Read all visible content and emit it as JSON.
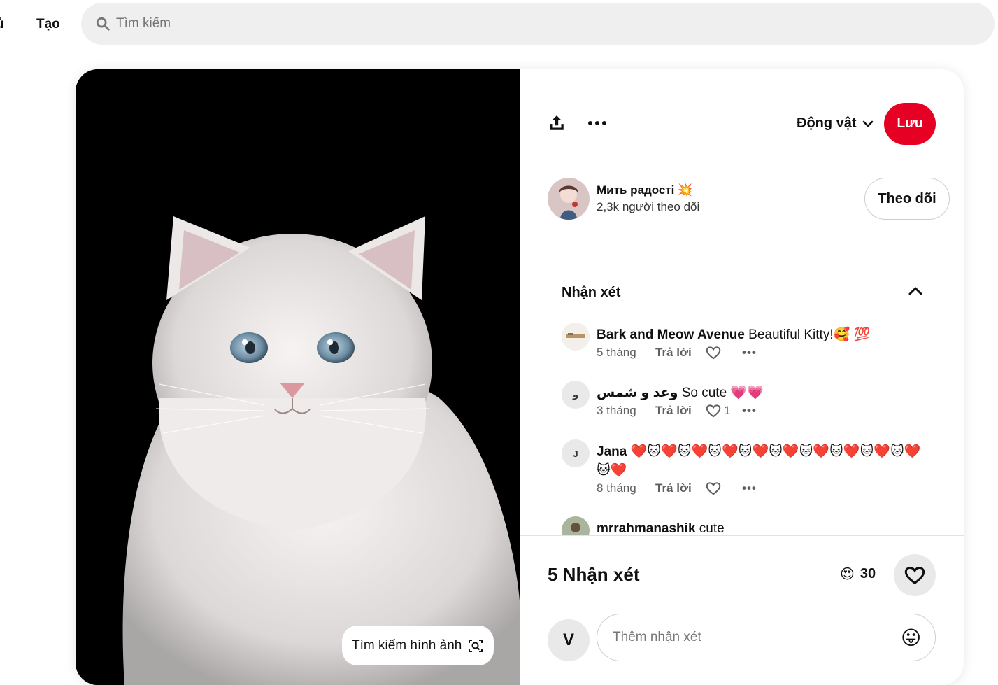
{
  "nav": {
    "home_label": "ủ",
    "create_label": "Tạo"
  },
  "search": {
    "placeholder": "Tìm kiếm"
  },
  "pin": {
    "visual_search_label": "Tìm kiếm hình ảnh",
    "board_name": "Động vật",
    "save_label": "Lưu",
    "creator": {
      "name": "Мить радості",
      "name_emoji": "💥",
      "followers": "2,3k người theo dõi",
      "follow_label": "Theo dõi"
    }
  },
  "comments": {
    "header": "Nhận xét",
    "reply_label": "Trả lời",
    "items": [
      {
        "avatar": "",
        "user": "Bark and Meow Avenue",
        "text": "Beautiful Kitty!🥰 💯",
        "age": "5 tháng",
        "likes": ""
      },
      {
        "avatar": "و",
        "user": "وعد و شمس",
        "text": "So cute 💗💗",
        "age": "3 tháng",
        "likes": "1"
      },
      {
        "avatar": "J",
        "user": "Jana",
        "text": "❤️🐱❤️🐱❤️🐱❤️🐱❤️🐱❤️🐱❤️🐱❤️🐱❤️🐱❤️🐱❤️",
        "age": "8 tháng",
        "likes": ""
      },
      {
        "avatar": "",
        "user": "mrrahmanashik",
        "text": "cute",
        "age": "",
        "likes": ""
      }
    ]
  },
  "footer": {
    "comment_count": "5 Nhận xét",
    "reaction_emoji": "😍",
    "reaction_count": "30"
  },
  "composer": {
    "avatar_letter": "V",
    "placeholder": "Thêm nhận xét",
    "emoji": "😛"
  },
  "colors": {
    "save": "#e60023",
    "search_bg": "#efefef",
    "avatar_bg": "#e9e9e9"
  }
}
